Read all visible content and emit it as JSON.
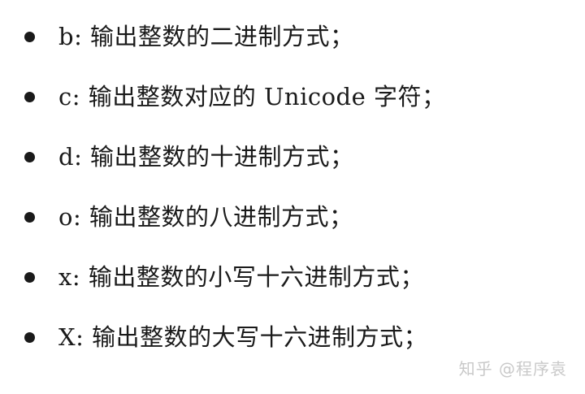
{
  "items": [
    {
      "text": "b: 输出整数的二进制方式；"
    },
    {
      "text": "c: 输出整数对应的 Unicode 字符；"
    },
    {
      "text": "d: 输出整数的十进制方式；"
    },
    {
      "text": "o: 输出整数的八进制方式；"
    },
    {
      "text": "x: 输出整数的小写十六进制方式；"
    },
    {
      "text": "X: 输出整数的大写十六进制方式；"
    }
  ],
  "watermark": "知乎 @程序袁"
}
